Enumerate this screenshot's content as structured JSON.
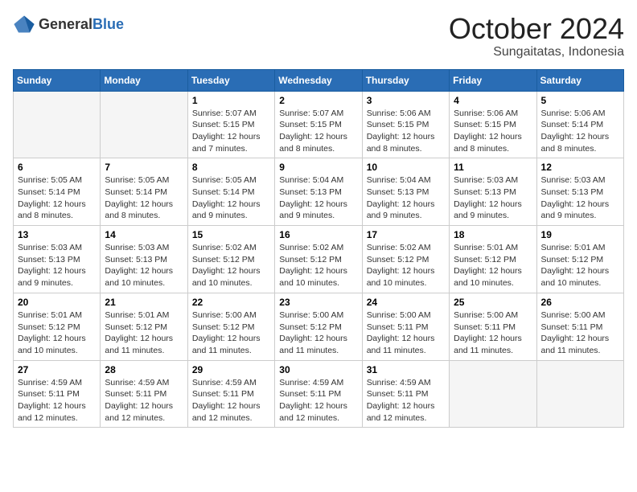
{
  "logo": {
    "general": "General",
    "blue": "Blue"
  },
  "header": {
    "month_year": "October 2024",
    "location": "Sungaitatas, Indonesia"
  },
  "weekdays": [
    "Sunday",
    "Monday",
    "Tuesday",
    "Wednesday",
    "Thursday",
    "Friday",
    "Saturday"
  ],
  "weeks": [
    [
      {
        "day": null
      },
      {
        "day": null
      },
      {
        "day": 1,
        "sunrise": "5:07 AM",
        "sunset": "5:15 PM",
        "daylight": "12 hours and 7 minutes."
      },
      {
        "day": 2,
        "sunrise": "5:07 AM",
        "sunset": "5:15 PM",
        "daylight": "12 hours and 8 minutes."
      },
      {
        "day": 3,
        "sunrise": "5:06 AM",
        "sunset": "5:15 PM",
        "daylight": "12 hours and 8 minutes."
      },
      {
        "day": 4,
        "sunrise": "5:06 AM",
        "sunset": "5:15 PM",
        "daylight": "12 hours and 8 minutes."
      },
      {
        "day": 5,
        "sunrise": "5:06 AM",
        "sunset": "5:14 PM",
        "daylight": "12 hours and 8 minutes."
      }
    ],
    [
      {
        "day": 6,
        "sunrise": "5:05 AM",
        "sunset": "5:14 PM",
        "daylight": "12 hours and 8 minutes."
      },
      {
        "day": 7,
        "sunrise": "5:05 AM",
        "sunset": "5:14 PM",
        "daylight": "12 hours and 8 minutes."
      },
      {
        "day": 8,
        "sunrise": "5:05 AM",
        "sunset": "5:14 PM",
        "daylight": "12 hours and 9 minutes."
      },
      {
        "day": 9,
        "sunrise": "5:04 AM",
        "sunset": "5:13 PM",
        "daylight": "12 hours and 9 minutes."
      },
      {
        "day": 10,
        "sunrise": "5:04 AM",
        "sunset": "5:13 PM",
        "daylight": "12 hours and 9 minutes."
      },
      {
        "day": 11,
        "sunrise": "5:03 AM",
        "sunset": "5:13 PM",
        "daylight": "12 hours and 9 minutes."
      },
      {
        "day": 12,
        "sunrise": "5:03 AM",
        "sunset": "5:13 PM",
        "daylight": "12 hours and 9 minutes."
      }
    ],
    [
      {
        "day": 13,
        "sunrise": "5:03 AM",
        "sunset": "5:13 PM",
        "daylight": "12 hours and 9 minutes."
      },
      {
        "day": 14,
        "sunrise": "5:03 AM",
        "sunset": "5:13 PM",
        "daylight": "12 hours and 10 minutes."
      },
      {
        "day": 15,
        "sunrise": "5:02 AM",
        "sunset": "5:12 PM",
        "daylight": "12 hours and 10 minutes."
      },
      {
        "day": 16,
        "sunrise": "5:02 AM",
        "sunset": "5:12 PM",
        "daylight": "12 hours and 10 minutes."
      },
      {
        "day": 17,
        "sunrise": "5:02 AM",
        "sunset": "5:12 PM",
        "daylight": "12 hours and 10 minutes."
      },
      {
        "day": 18,
        "sunrise": "5:01 AM",
        "sunset": "5:12 PM",
        "daylight": "12 hours and 10 minutes."
      },
      {
        "day": 19,
        "sunrise": "5:01 AM",
        "sunset": "5:12 PM",
        "daylight": "12 hours and 10 minutes."
      }
    ],
    [
      {
        "day": 20,
        "sunrise": "5:01 AM",
        "sunset": "5:12 PM",
        "daylight": "12 hours and 10 minutes."
      },
      {
        "day": 21,
        "sunrise": "5:01 AM",
        "sunset": "5:12 PM",
        "daylight": "12 hours and 11 minutes."
      },
      {
        "day": 22,
        "sunrise": "5:00 AM",
        "sunset": "5:12 PM",
        "daylight": "12 hours and 11 minutes."
      },
      {
        "day": 23,
        "sunrise": "5:00 AM",
        "sunset": "5:12 PM",
        "daylight": "12 hours and 11 minutes."
      },
      {
        "day": 24,
        "sunrise": "5:00 AM",
        "sunset": "5:11 PM",
        "daylight": "12 hours and 11 minutes."
      },
      {
        "day": 25,
        "sunrise": "5:00 AM",
        "sunset": "5:11 PM",
        "daylight": "12 hours and 11 minutes."
      },
      {
        "day": 26,
        "sunrise": "5:00 AM",
        "sunset": "5:11 PM",
        "daylight": "12 hours and 11 minutes."
      }
    ],
    [
      {
        "day": 27,
        "sunrise": "4:59 AM",
        "sunset": "5:11 PM",
        "daylight": "12 hours and 12 minutes."
      },
      {
        "day": 28,
        "sunrise": "4:59 AM",
        "sunset": "5:11 PM",
        "daylight": "12 hours and 12 minutes."
      },
      {
        "day": 29,
        "sunrise": "4:59 AM",
        "sunset": "5:11 PM",
        "daylight": "12 hours and 12 minutes."
      },
      {
        "day": 30,
        "sunrise": "4:59 AM",
        "sunset": "5:11 PM",
        "daylight": "12 hours and 12 minutes."
      },
      {
        "day": 31,
        "sunrise": "4:59 AM",
        "sunset": "5:11 PM",
        "daylight": "12 hours and 12 minutes."
      },
      {
        "day": null
      },
      {
        "day": null
      }
    ]
  ],
  "labels": {
    "sunrise": "Sunrise:",
    "sunset": "Sunset:",
    "daylight": "Daylight:"
  }
}
